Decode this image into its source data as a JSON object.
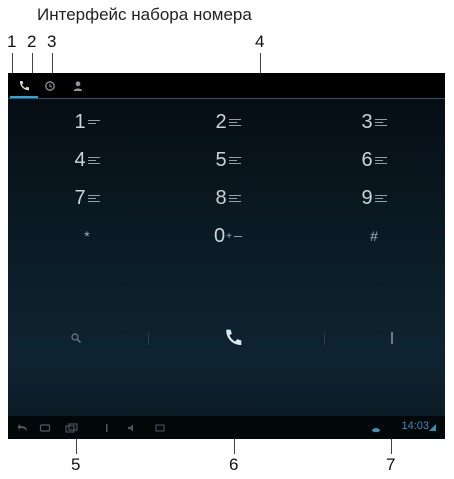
{
  "caption": "Интерфейс набора номера",
  "callouts": [
    "1",
    "2",
    "3",
    "4",
    "5",
    "6",
    "7"
  ],
  "tabs": [
    {
      "icon": "phone-icon",
      "active": true
    },
    {
      "icon": "clock-icon",
      "active": false
    },
    {
      "icon": "person-icon",
      "active": false
    }
  ],
  "keypad": [
    {
      "digit": "1",
      "letters": true
    },
    {
      "digit": "2",
      "letters": true
    },
    {
      "digit": "3",
      "letters": true
    },
    {
      "digit": "4",
      "letters": true
    },
    {
      "digit": "5",
      "letters": true
    },
    {
      "digit": "6",
      "letters": true
    },
    {
      "digit": "7",
      "letters": true
    },
    {
      "digit": "8",
      "letters": true
    },
    {
      "digit": "9",
      "letters": true
    },
    {
      "digit": "*",
      "letters": false
    },
    {
      "digit": "0",
      "sub": "+"
    },
    {
      "digit": "#",
      "letters": false
    }
  ],
  "actions": {
    "left_icon": "search-icon",
    "center_icon": "call-icon",
    "right_icon": "menu-icon"
  },
  "statusbar": {
    "time": "14:03"
  },
  "colors": {
    "accent": "#2fa7d9",
    "screen_bg": "#0b1b25"
  }
}
